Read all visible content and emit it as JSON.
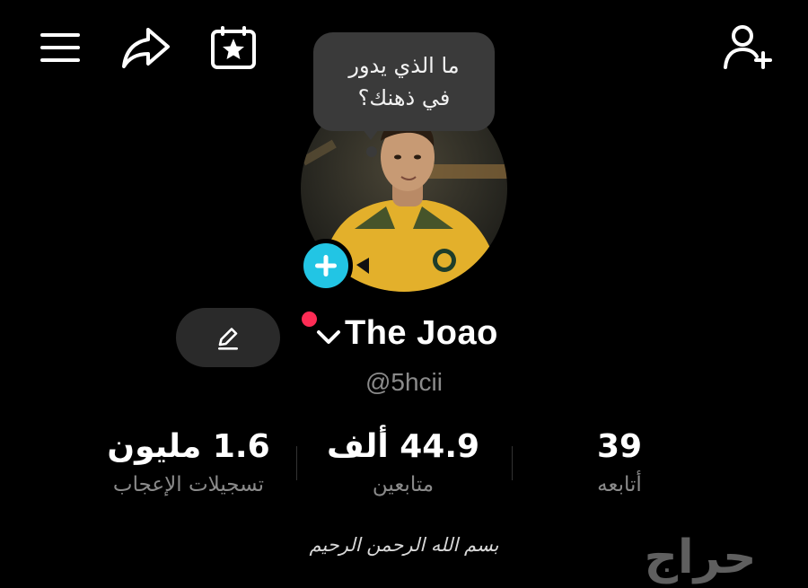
{
  "header": {
    "icons": [
      "menu-icon",
      "share-icon",
      "calendar-star-icon",
      "add-friend-icon"
    ]
  },
  "profile": {
    "note_bubble": {
      "line1": "ما الذي يدور",
      "line2": "في ذهنك؟"
    },
    "display_name": "The Joao",
    "username": "@5hcii"
  },
  "stats": {
    "likes": {
      "value": "1.6 مليون",
      "label": "تسجيلات الإعجاب"
    },
    "followers": {
      "value": "44.9 ألف",
      "label": "متابعين"
    },
    "following": {
      "value": "39",
      "label": "أتابعه"
    }
  },
  "footer": {
    "basmala": "بسم الله الرحمن الرحيم",
    "watermark": "حراج"
  },
  "colors": {
    "background": "#000000",
    "add_button": "#22c5e4",
    "notification_dot": "#fe2c55",
    "secondary_text": "#8a8a8a"
  }
}
